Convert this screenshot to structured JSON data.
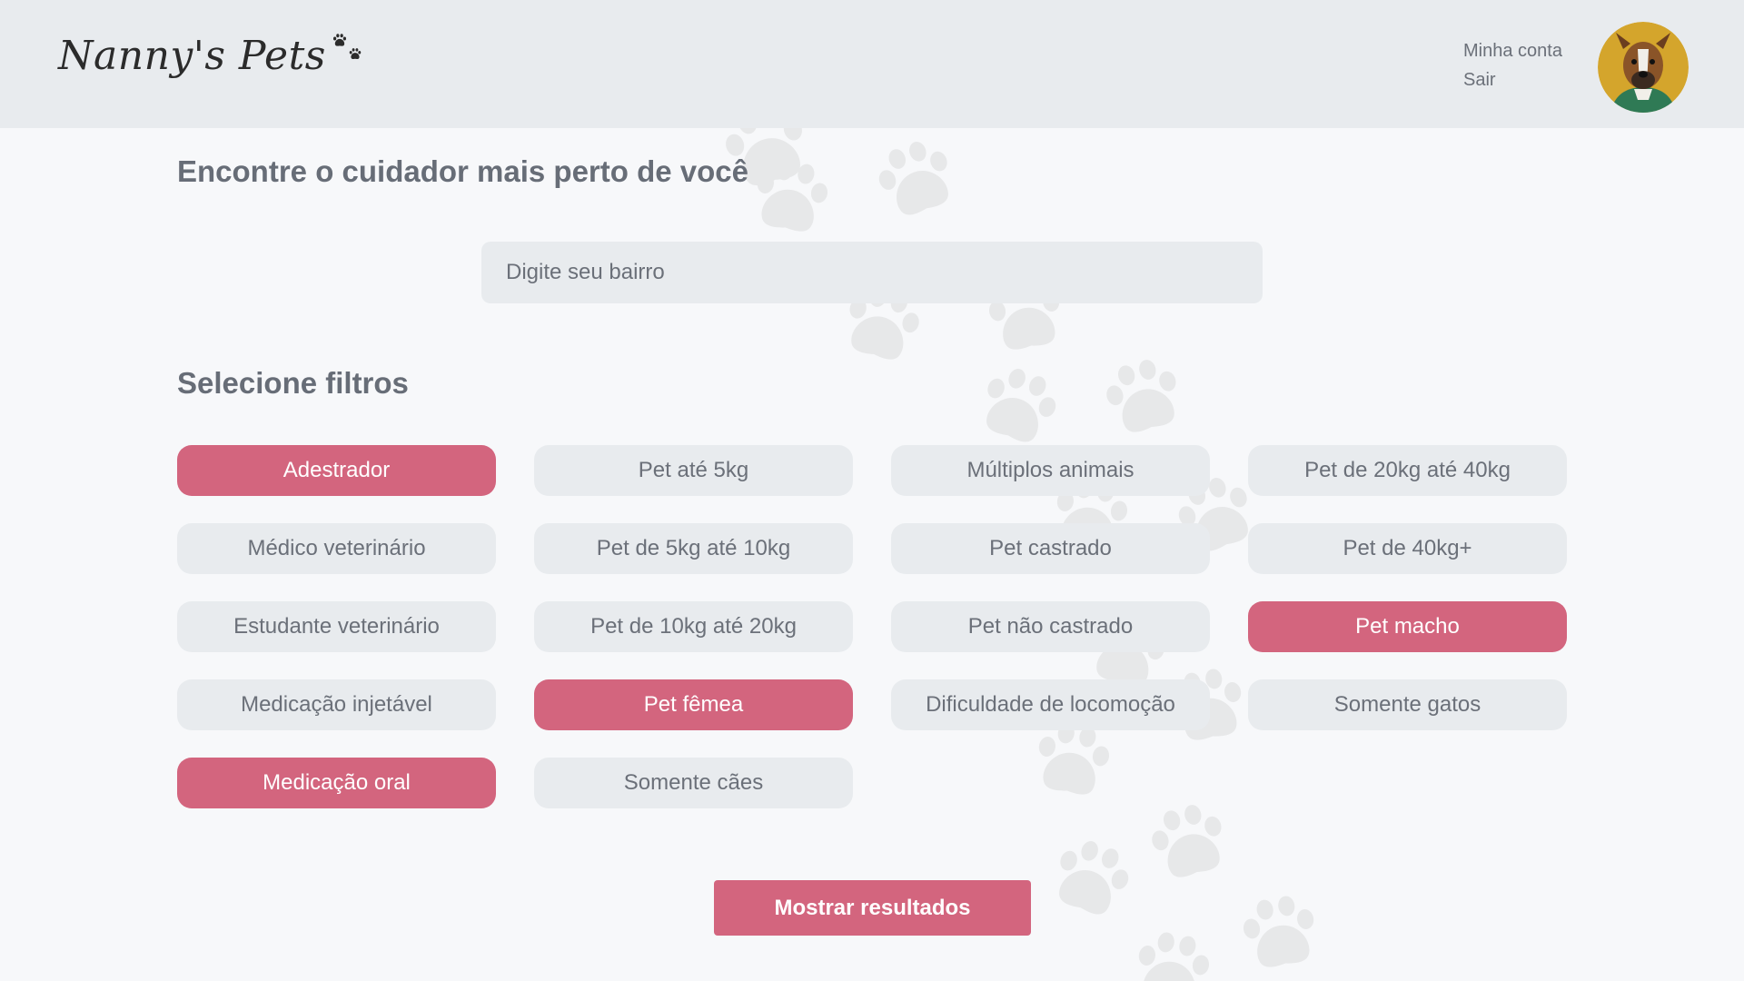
{
  "header": {
    "logo_text": "Nanny's Pets",
    "account_link": "Minha conta",
    "logout_link": "Sair",
    "avatar_icon": "dog-avatar"
  },
  "search": {
    "title": "Encontre o cuidador mais perto de você",
    "placeholder": "Digite seu bairro",
    "value": ""
  },
  "filters": {
    "title": "Selecione filtros",
    "items": [
      {
        "label": "Adestrador",
        "selected": true
      },
      {
        "label": "Pet até 5kg",
        "selected": false
      },
      {
        "label": "Múltiplos animais",
        "selected": false
      },
      {
        "label": "Pet de 20kg até 40kg",
        "selected": false
      },
      {
        "label": "Médico veterinário",
        "selected": false
      },
      {
        "label": "Pet de 5kg até 10kg",
        "selected": false
      },
      {
        "label": "Pet castrado",
        "selected": false
      },
      {
        "label": "Pet de 40kg+",
        "selected": false
      },
      {
        "label": "Estudante veterinário",
        "selected": false
      },
      {
        "label": "Pet de 10kg até 20kg",
        "selected": false
      },
      {
        "label": "Pet não castrado",
        "selected": false
      },
      {
        "label": "Pet macho",
        "selected": true
      },
      {
        "label": "Medicação injetável",
        "selected": false
      },
      {
        "label": "Pet fêmea",
        "selected": true
      },
      {
        "label": "Dificuldade de locomoção",
        "selected": false
      },
      {
        "label": "Somente gatos",
        "selected": false
      },
      {
        "label": "Medicação oral",
        "selected": true
      },
      {
        "label": "Somente cães",
        "selected": false
      }
    ]
  },
  "actions": {
    "show_results_label": "Mostrar resultados"
  },
  "colors": {
    "accent": "#d3657e",
    "chip_bg": "#e8ebee",
    "header_bg": "#e8ebee",
    "page_bg": "#f7f8fa",
    "text": "#6b7079"
  }
}
